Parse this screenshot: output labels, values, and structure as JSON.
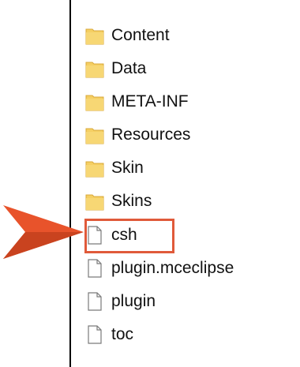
{
  "explorer": {
    "items": [
      {
        "name": "Content",
        "type": "folder"
      },
      {
        "name": "Data",
        "type": "folder"
      },
      {
        "name": "META-INF",
        "type": "folder"
      },
      {
        "name": "Resources",
        "type": "folder"
      },
      {
        "name": "Skin",
        "type": "folder"
      },
      {
        "name": "Skins",
        "type": "folder"
      },
      {
        "name": "csh",
        "type": "file"
      },
      {
        "name": "plugin.mceclipse",
        "type": "file"
      },
      {
        "name": "plugin",
        "type": "file"
      },
      {
        "name": "toc",
        "type": "file"
      }
    ],
    "highlighted_item": "csh"
  },
  "colors": {
    "folder_fill": "#f5cf63",
    "folder_edge": "#d9a83a",
    "file_stroke": "#7a7a7a",
    "highlight_border": "#e05a3a",
    "arrow_main": "#e8532b",
    "arrow_shadow": "#b23a1c"
  },
  "icons": {
    "folder": "folder-icon",
    "file": "file-icon",
    "pointer": "arrow-pointer-icon"
  }
}
